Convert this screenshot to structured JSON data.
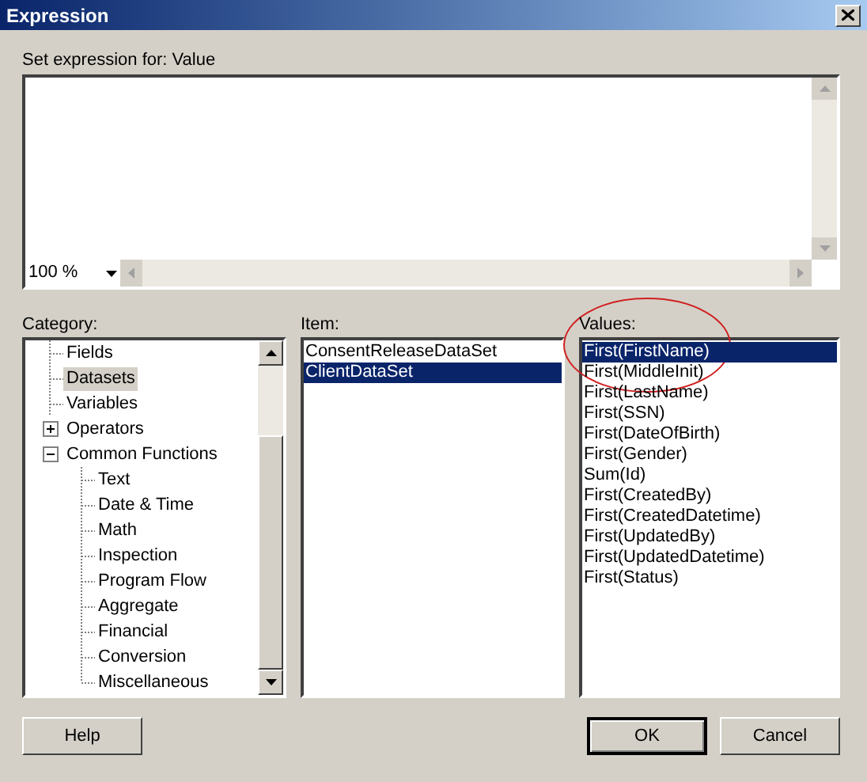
{
  "window": {
    "title": "Expression"
  },
  "expression": {
    "label": "Set expression for: Value",
    "zoom": "100 %"
  },
  "category": {
    "label": "Category:",
    "items": [
      {
        "label": "Fields",
        "selected": false
      },
      {
        "label": "Datasets",
        "selected": true
      },
      {
        "label": "Variables",
        "selected": false
      },
      {
        "label": "Operators",
        "selected": false,
        "expanded": false
      },
      {
        "label": "Common Functions",
        "selected": false,
        "expanded": true,
        "children": [
          {
            "label": "Text",
            "selected": false
          },
          {
            "label": "Date & Time",
            "selected": false
          },
          {
            "label": "Math",
            "selected": false
          },
          {
            "label": "Inspection",
            "selected": false
          },
          {
            "label": "Program Flow",
            "selected": false
          },
          {
            "label": "Aggregate",
            "selected": false
          },
          {
            "label": "Financial",
            "selected": false
          },
          {
            "label": "Conversion",
            "selected": false
          },
          {
            "label": "Miscellaneous",
            "selected": false
          }
        ]
      }
    ]
  },
  "item": {
    "label": "Item:",
    "items": [
      {
        "label": "ConsentReleaseDataSet",
        "selected": false
      },
      {
        "label": "ClientDataSet",
        "selected": true
      }
    ]
  },
  "values": {
    "label": "Values:",
    "items": [
      {
        "label": "First(FirstName)",
        "selected": true
      },
      {
        "label": "First(MiddleInit)",
        "selected": false
      },
      {
        "label": "First(LastName)",
        "selected": false
      },
      {
        "label": "First(SSN)",
        "selected": false
      },
      {
        "label": "First(DateOfBirth)",
        "selected": false
      },
      {
        "label": "First(Gender)",
        "selected": false
      },
      {
        "label": "Sum(Id)",
        "selected": false
      },
      {
        "label": "First(CreatedBy)",
        "selected": false
      },
      {
        "label": "First(CreatedDatetime)",
        "selected": false
      },
      {
        "label": "First(UpdatedBy)",
        "selected": false
      },
      {
        "label": "First(UpdatedDatetime)",
        "selected": false
      },
      {
        "label": "First(Status)",
        "selected": false
      }
    ]
  },
  "buttons": [
    {
      "label": "Help",
      "default": false
    },
    {
      "label": "OK",
      "default": true
    },
    {
      "label": "Cancel",
      "default": false
    }
  ]
}
